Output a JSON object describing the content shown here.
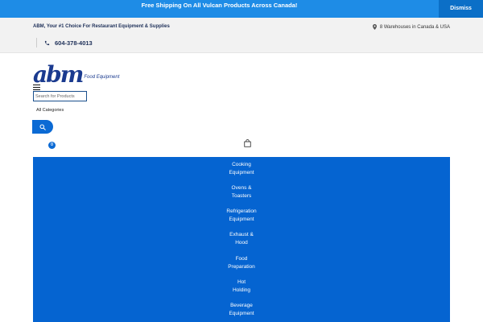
{
  "notice": {
    "text": "Free Shipping On All Vulcan Products Across Canada!",
    "dismiss_label": "Dismiss"
  },
  "topbar": {
    "tagline": "ABM, Your #1 Choice For Restaurant Equipment & Supplies",
    "warehouses": "8 Warehouses in Canada & USA",
    "phone": "604-378-4013"
  },
  "logo": {
    "mark": "abm",
    "sub": "Food Equipment"
  },
  "search": {
    "placeholder": "Search for Products",
    "categories_label": "All Categories"
  },
  "cart": {
    "count": "0"
  },
  "nav": {
    "items": [
      {
        "line1": "Cooking",
        "line2": "Equipment"
      },
      {
        "line1": "Ovens &",
        "line2": "Toasters"
      },
      {
        "line1": "Refrigeration",
        "line2": "Equipment"
      },
      {
        "line1": "Exhaust &",
        "line2": "Hood"
      },
      {
        "line1": "Food",
        "line2": "Preparation"
      },
      {
        "line1": "Hot",
        "line2": "Holding"
      },
      {
        "line1": "Beverage",
        "line2": "Equipment"
      }
    ]
  },
  "colors": {
    "notice_bg": "#1e8ce6",
    "dismiss_bg": "#0b6fc7",
    "nav_bg": "#0564d1",
    "brand": "#1a3a8f"
  },
  "icons": {
    "location": "map-pin-icon",
    "phone": "phone-icon",
    "menu": "hamburger-icon",
    "search": "search-icon",
    "cart": "shopping-bag-icon"
  }
}
